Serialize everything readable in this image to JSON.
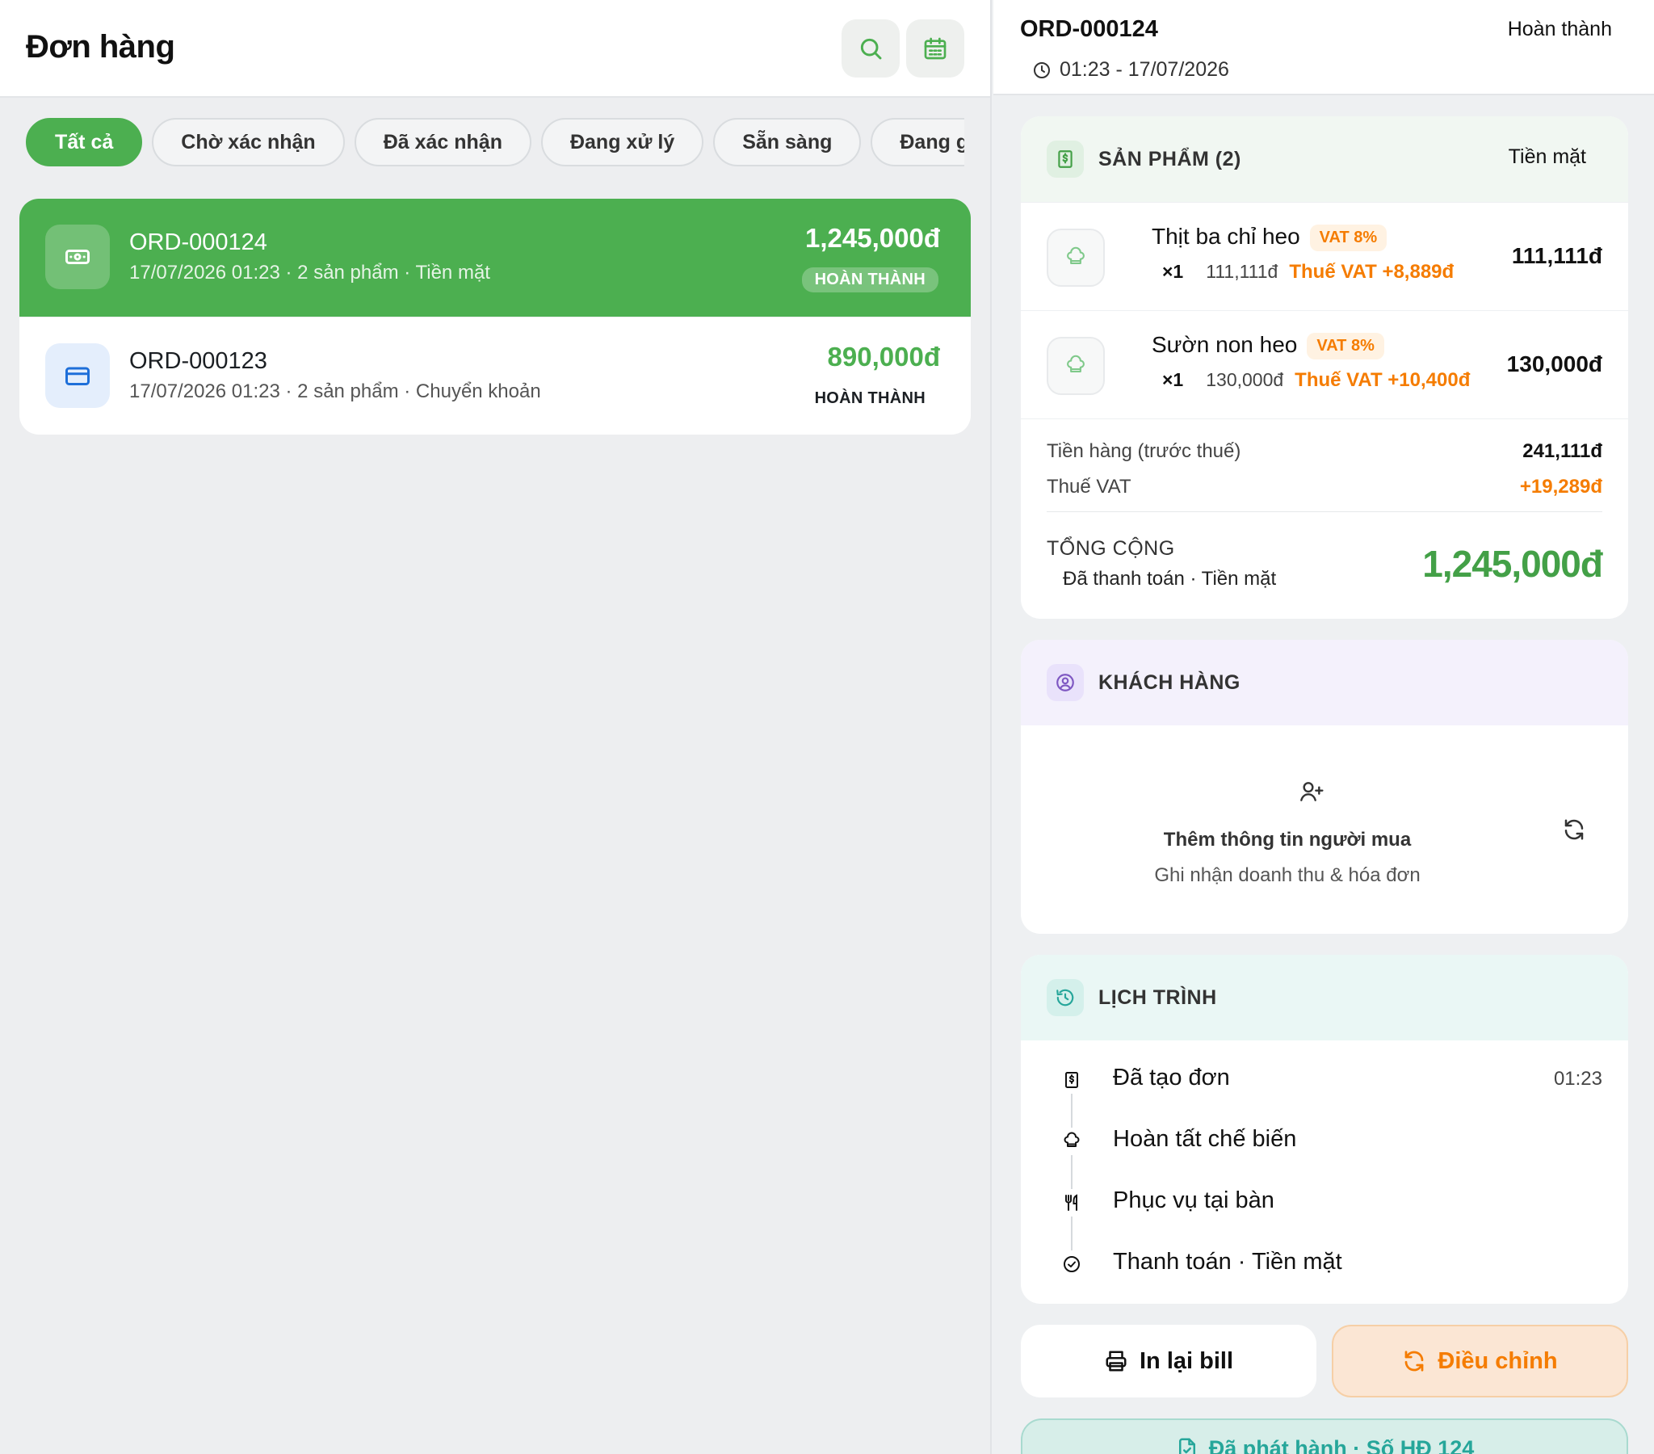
{
  "colors": {
    "primary": "#4caf50",
    "accent_orange": "#f57c00",
    "accent_teal": "#26a69a",
    "accent_purple": "#7e57c2",
    "accent_blue": "#1e6fd9"
  },
  "left": {
    "title": "Đơn hàng",
    "search_icon": "search-icon",
    "calendar_icon": "calendar-icon",
    "filters": [
      "Tất cả",
      "Chờ xác nhận",
      "Đã xác nhận",
      "Đang xử lý",
      "Sẵn sàng",
      "Đang gia"
    ],
    "orders": [
      {
        "id": "ORD-000124",
        "meta": "17/07/2026 01:23 · 2 sản phẩm · Tiền mặt",
        "amount": "1,245,000đ",
        "status": "HOÀN THÀNH",
        "icon": "cash-icon",
        "selected": true
      },
      {
        "id": "ORD-000123",
        "meta": "17/07/2026 01:23 · 2 sản phẩm · Chuyển khoản",
        "amount": "890,000đ",
        "status": "HOÀN THÀNH",
        "icon": "card-icon",
        "selected": false
      }
    ]
  },
  "detail": {
    "order_id": "ORD-000124",
    "status": "Hoàn thành",
    "datetime": "01:23 - 17/07/2026",
    "products": {
      "title": "SẢN PHẨM (2)",
      "payment": "Tiền mặt",
      "items": [
        {
          "name": "Thịt ba chỉ heo",
          "vat": "VAT 8%",
          "qty": "×1",
          "unit_price": "111,111đ",
          "tax": "Thuế VAT +8,889đ",
          "total": "111,111đ"
        },
        {
          "name": "Sườn non heo",
          "vat": "VAT 8%",
          "qty": "×1",
          "unit_price": "130,000đ",
          "tax": "Thuế VAT +10,400đ",
          "total": "130,000đ"
        }
      ],
      "subtotal_label": "Tiền hàng (trước thuế)",
      "subtotal": "241,111đ",
      "vat_label": "Thuế VAT",
      "vat": "+19,289đ",
      "total_label": "TỔNG CỘNG",
      "total_sub": "Đã thanh toán · Tiền mặt",
      "total": "1,245,000đ"
    },
    "customer": {
      "title": "KHÁCH HÀNG",
      "add_title": "Thêm thông tin người mua",
      "add_sub": "Ghi nhận doanh thu & hóa đơn"
    },
    "timeline": {
      "title": "LỊCH TRÌNH",
      "items": [
        {
          "label": "Đã tạo đơn",
          "time": "01:23",
          "icon": "receipt-icon"
        },
        {
          "label": "Hoàn tất chế biến",
          "time": "",
          "icon": "chef-hat-icon"
        },
        {
          "label": "Phục vụ tại bàn",
          "time": "",
          "icon": "utensils-icon"
        },
        {
          "label": "Thanh toán · Tiền mặt",
          "time": "",
          "icon": "check-circle-icon"
        }
      ]
    },
    "actions": {
      "print": "In lại bill",
      "adjust": "Điều chỉnh"
    },
    "issued": "Đã phát hành · Số HĐ 124"
  }
}
